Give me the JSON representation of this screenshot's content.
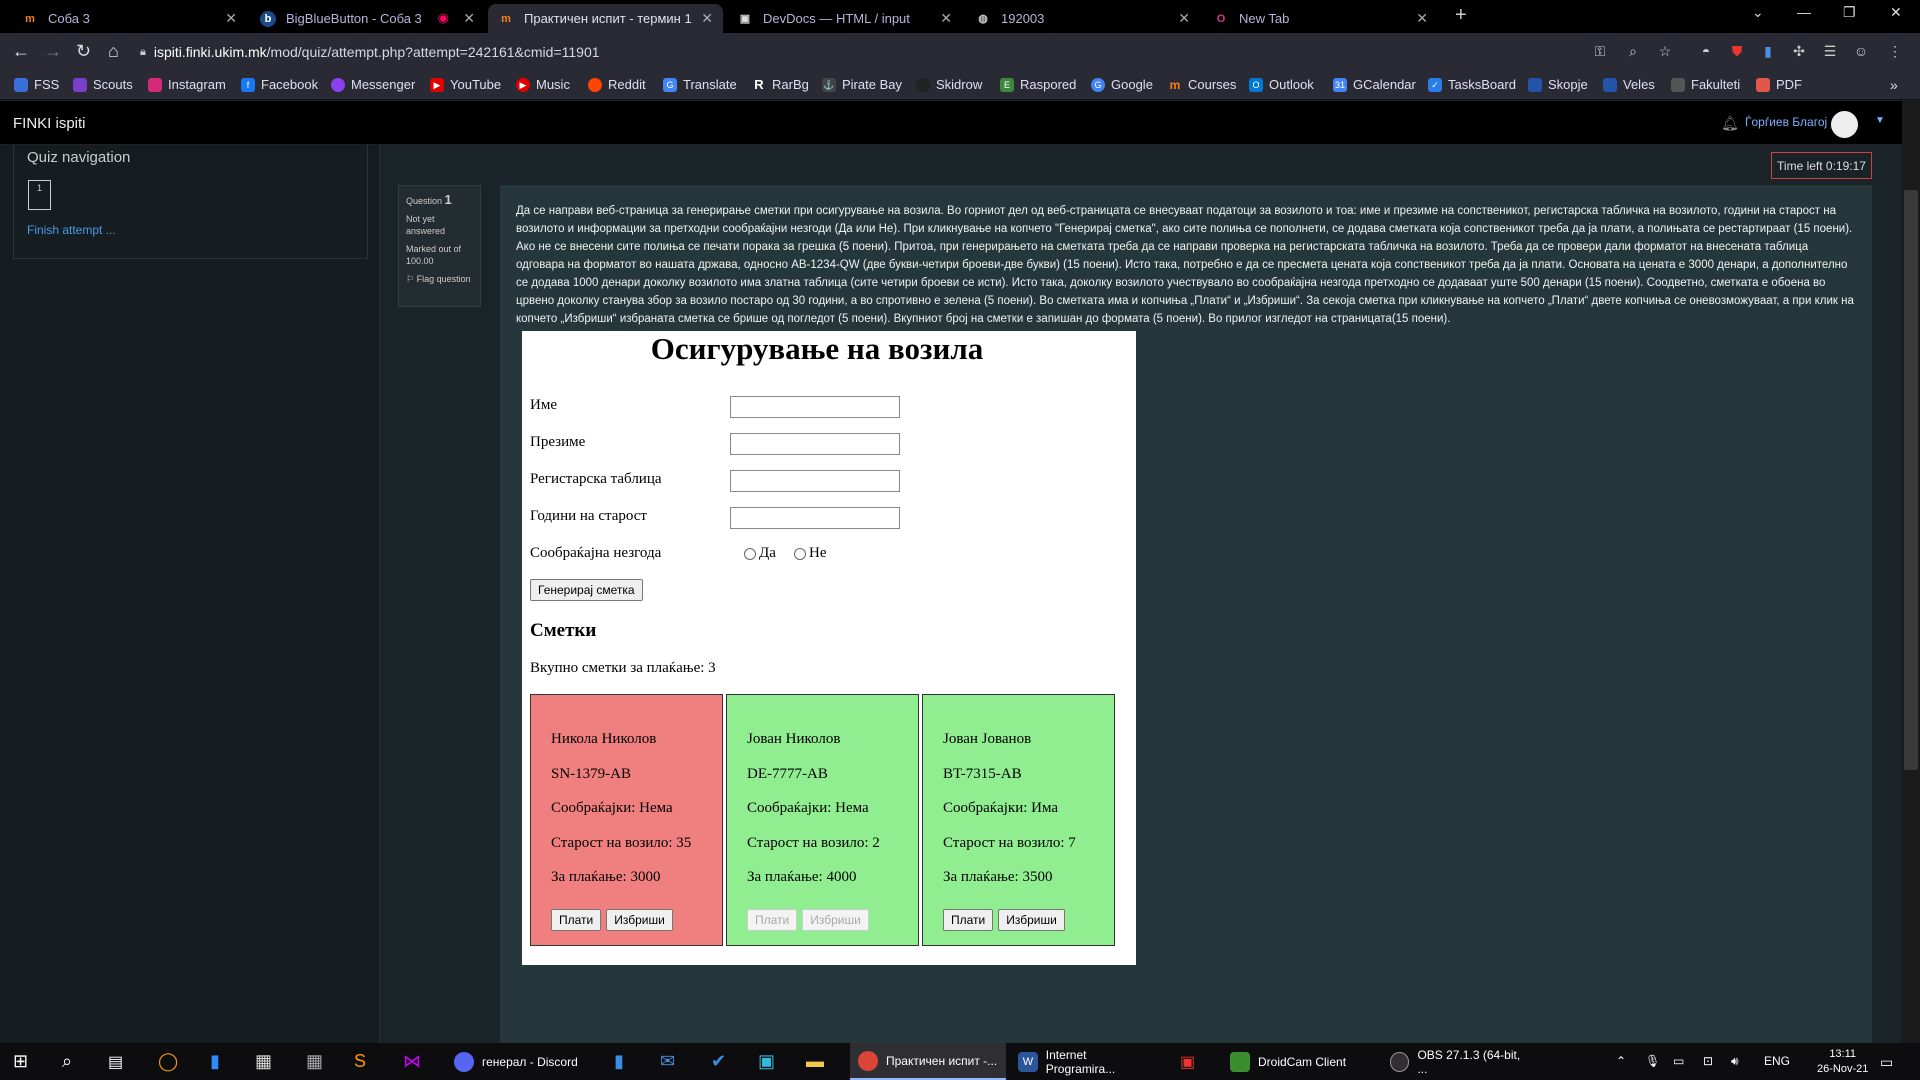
{
  "tabs": [
    {
      "title": "Соба 3",
      "icon": "moodle-icon",
      "active": false
    },
    {
      "title": "BigBlueButton - Соба 3",
      "icon": "bigbluebutton-icon",
      "active": false
    },
    {
      "title": "Практичен испит - термин 1",
      "icon": "moodle-icon",
      "active": true
    },
    {
      "title": "DevDocs — HTML / input",
      "icon": "devdocs-icon",
      "active": false
    },
    {
      "title": "192003",
      "icon": "globe-icon",
      "active": false
    },
    {
      "title": "New Tab",
      "icon": "opera-icon",
      "active": false
    }
  ],
  "address": {
    "host": "ispiti.finki.ukim.mk",
    "path": "/mod/quiz/attempt.php?attempt=242161&cmid=11901"
  },
  "bookmarks": [
    {
      "label": "FSS",
      "color": "#3a6fd8"
    },
    {
      "label": "Scouts",
      "color": "#7a3ec8"
    },
    {
      "label": "Instagram",
      "color": "#d6297a"
    },
    {
      "label": "Facebook",
      "color": "#1877f2"
    },
    {
      "label": "Messenger",
      "color": "#8a3ff0"
    },
    {
      "label": "YouTube",
      "color": "#e00000"
    },
    {
      "label": "Music",
      "color": "#e00000"
    },
    {
      "label": "Reddit",
      "color": "#ff4500"
    },
    {
      "label": "Translate",
      "color": "#4285f4"
    },
    {
      "label": "RarBg",
      "color": "#334"
    },
    {
      "label": "Pirate Bay",
      "color": "#444"
    },
    {
      "label": "Skidrow",
      "color": "#222"
    },
    {
      "label": "Raspored",
      "color": "#3b8a3b"
    },
    {
      "label": "Google",
      "color": "#4285f4"
    },
    {
      "label": "Courses",
      "color": "#f98012"
    },
    {
      "label": "Outlook",
      "color": "#0078d4"
    },
    {
      "label": "GCalendar",
      "color": "#4285f4"
    },
    {
      "label": "TasksBoard",
      "color": "#2b7de9"
    },
    {
      "label": "Skopje",
      "color": "#2255aa"
    },
    {
      "label": "Veles",
      "color": "#2255aa"
    },
    {
      "label": "Fakulteti",
      "color": "#555"
    },
    {
      "label": "PDF",
      "color": "#e2574c"
    }
  ],
  "moodle": {
    "site_name": "FINKI ispiti",
    "user_name": "Ѓорѓиев Благој"
  },
  "quiz_nav": {
    "title": "Quiz navigation",
    "question_number": "1",
    "finish_link": "Finish attempt ..."
  },
  "timer": "Time left 0:19:17",
  "question_info": {
    "label": "Question",
    "number": "1",
    "status": "Not yet answered",
    "marked": "Marked out of 100.00",
    "flag": "Flag question"
  },
  "question_text": "Да се направи веб-страница за генерирање сметки при осигурување на возила. Во горниот дел од веб-страницата се внесуваат податоци за возилото и тоа: име и презиме на сопственикот, регистарска табличка на возилото, години на старост на возилото и информации за претходни сообраќајни незгоди (Да или Не). При кликнување на копчето \"Генерирај сметка\", ако сите полиња се пополнети, се додава сметката која сопственикот треба да ја плати, а полињата се рестартираат (15 поени). Ако не се внесени сите полиња се печати порака за грешка (5 поени). Притоа, при генерирањето на сметката треба да се направи проверка на регистарската табличка на возилото. Треба да се провери дали форматот на внесената таблица одговара на форматот во нашата држава, односно АВ-1234-QW (две букви-четири броеви-две букви) (15 поени). Исто така, потребно е да се пресмета цената која сопственикот треба да ја плати. Основата на цената е 3000 денари, а дополнително се додава 1000 денари доколку возилото има златна таблица (сите четири броеви се исти). Исто така, доколку возилото учествувало во сообраќајна незгода претходно се додаваат уште 500 денари (15 поени). Соодветно, сметката е обоена во црвено доколку станува збор за возило постаро од 30 години, а во спротивно е зелена (5 поени). Во сметката има и копчиња „Плати“ и „Избриши“. За секоја сметка при кликнување на копчето „Плати“ двете копчиња се оневозможуваат, а при клик на копчето „Избриши“ избраната сметка се брише од погледот (5 поени). Вкупниот број на сметки е запишан до формата (5 поени). Во прилог изгледот на страницата(15 поени).",
  "page": {
    "title": "Осигурување на возила",
    "fields": [
      {
        "label": "Име"
      },
      {
        "label": "Презиме"
      },
      {
        "label": "Регистарска таблица"
      },
      {
        "label": "Години на старост"
      }
    ],
    "accident_label": "Сообраќајна незгода",
    "accident_yes": "Да",
    "accident_no": "Не",
    "generate_button": "Генерирај сметка",
    "bills_heading": "Сметки",
    "bills_total": "Вкупно сметки за плаќање: 3",
    "pay_label": "Плати",
    "delete_label": "Избриши",
    "bills": [
      {
        "name": "Никола Николов",
        "plate": "SN-1379-AB",
        "accidents": "Сообраќајки: Нема",
        "age": "Старост на возило: 35",
        "price": "За плаќање: 3000",
        "color": "#f08080",
        "disabled": false
      },
      {
        "name": "Јован Николов",
        "plate": "DE-7777-AB",
        "accidents": "Сообраќајки: Нема",
        "age": "Старост на возило: 2",
        "price": "За плаќање: 4000",
        "color": "#90ee90",
        "disabled": true
      },
      {
        "name": "Јован Јованов",
        "plate": "BT-7315-AB",
        "accidents": "Сообраќајки: Има",
        "age": "Старост на возило: 7",
        "price": "За плаќање: 3500",
        "color": "#90ee90",
        "disabled": false
      }
    ]
  },
  "taskbar": {
    "items": [
      {
        "label": "генерал - Discord",
        "icon": "discord-icon",
        "color": "#5865f2",
        "active": false
      },
      {
        "label": "Практичен испит -...",
        "icon": "chrome-icon",
        "color": "#db4437",
        "active": true
      },
      {
        "label": "Internet Programira...",
        "icon": "word-icon",
        "color": "#2b579a",
        "active": false
      },
      {
        "label": "DroidCam Client",
        "icon": "droidcam-icon",
        "color": "#3c8d2f",
        "active": false
      },
      {
        "label": "OBS 27.1.3 (64-bit, ...",
        "icon": "obs-icon",
        "color": "#302e31",
        "active": false
      }
    ],
    "language": "ENG",
    "time": "13:11",
    "date": "26-Nov-21"
  }
}
